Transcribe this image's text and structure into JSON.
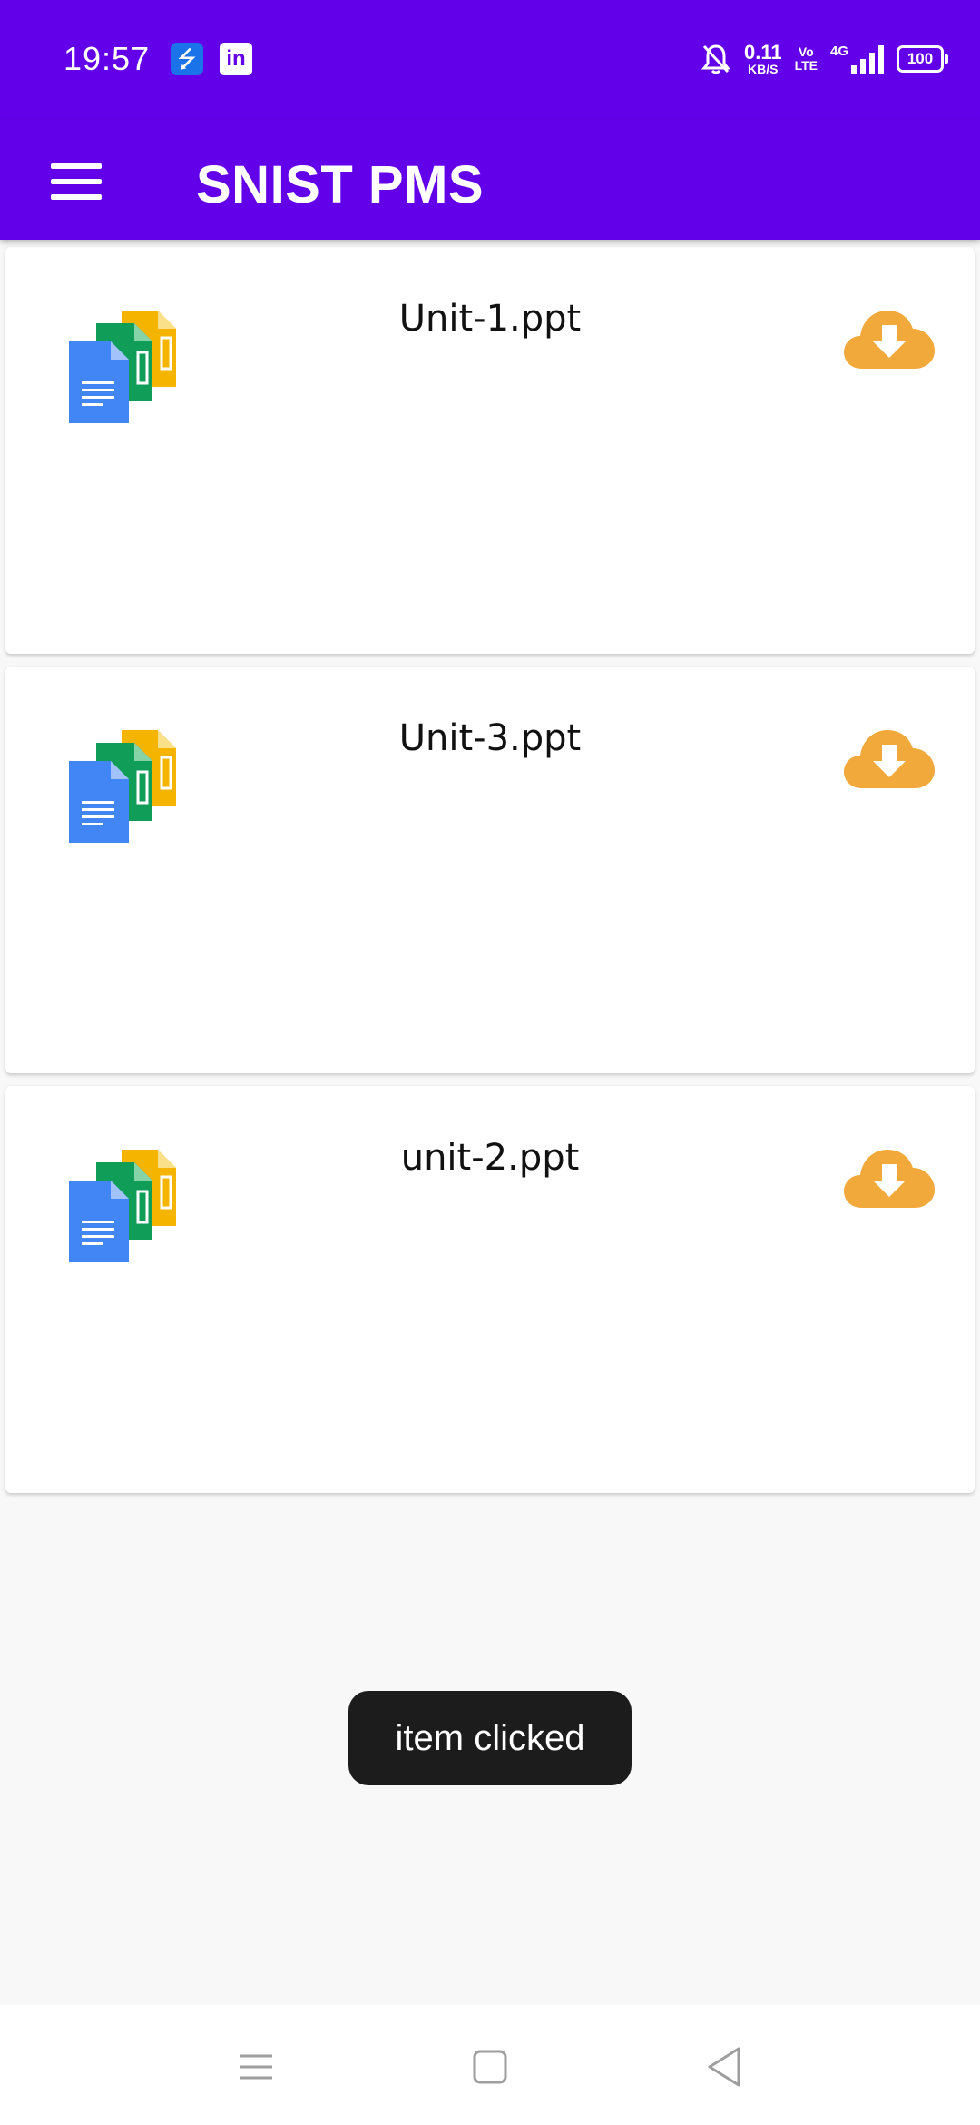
{
  "status_bar": {
    "time": "19:57",
    "usb_icon": "usb-icon",
    "linkedin_label": "in",
    "net_speed_value": "0.11",
    "net_speed_unit": "KB/S",
    "volte_top": "Vo",
    "volte_bottom": "LTE",
    "network_type": "4G",
    "battery_level": "100"
  },
  "toolbar": {
    "title": "SNIST PMS",
    "menu_icon": "hamburger-menu-icon",
    "color": "#6200ea"
  },
  "files": [
    {
      "name": "Unit-1.ppt",
      "icon": "documents-stack-icon",
      "action_icon": "cloud-download-icon"
    },
    {
      "name": "Unit-3.ppt",
      "icon": "documents-stack-icon",
      "action_icon": "cloud-download-icon"
    },
    {
      "name": "unit-2.ppt",
      "icon": "documents-stack-icon",
      "action_icon": "cloud-download-icon"
    }
  ],
  "toast": {
    "message": "item clicked"
  },
  "nav_bar": {
    "recents_icon": "recents-icon",
    "home_icon": "home-icon",
    "back_icon": "back-icon"
  },
  "colors": {
    "primary": "#6200ea",
    "download_accent": "#f2a93b",
    "doc_blue": "#4285f4",
    "doc_green": "#0f9d58",
    "doc_yellow": "#f4b400"
  }
}
